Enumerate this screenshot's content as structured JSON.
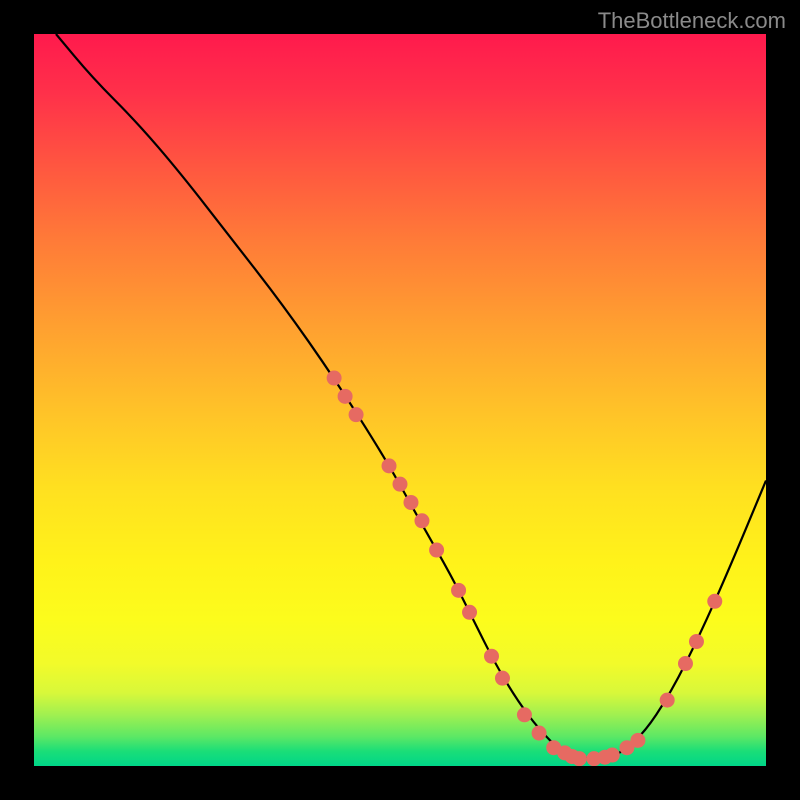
{
  "watermark": "TheBottleneck.com",
  "chart_data": {
    "type": "line",
    "title": "",
    "xlabel": "",
    "ylabel": "",
    "xlim": [
      0,
      100
    ],
    "ylim": [
      0,
      100
    ],
    "series": [
      {
        "name": "curve",
        "x": [
          3,
          8,
          14,
          20,
          27,
          34,
          41,
          48,
          53,
          57,
          60,
          63,
          66,
          69,
          72,
          75,
          79,
          83,
          87,
          91,
          95,
          100
        ],
        "y": [
          100,
          94,
          88,
          81,
          72,
          63,
          53,
          42,
          33,
          26,
          20,
          14,
          9,
          5,
          2,
          1,
          1,
          4,
          10,
          18,
          27,
          39
        ]
      }
    ],
    "markers": [
      {
        "x": 41.0,
        "y": 53.0
      },
      {
        "x": 42.5,
        "y": 50.5
      },
      {
        "x": 44.0,
        "y": 48.0
      },
      {
        "x": 48.5,
        "y": 41.0
      },
      {
        "x": 50.0,
        "y": 38.5
      },
      {
        "x": 51.5,
        "y": 36.0
      },
      {
        "x": 53.0,
        "y": 33.5
      },
      {
        "x": 55.0,
        "y": 29.5
      },
      {
        "x": 58.0,
        "y": 24.0
      },
      {
        "x": 59.5,
        "y": 21.0
      },
      {
        "x": 62.5,
        "y": 15.0
      },
      {
        "x": 64.0,
        "y": 12.0
      },
      {
        "x": 67.0,
        "y": 7.0
      },
      {
        "x": 69.0,
        "y": 4.5
      },
      {
        "x": 71.0,
        "y": 2.5
      },
      {
        "x": 72.5,
        "y": 1.8
      },
      {
        "x": 73.5,
        "y": 1.3
      },
      {
        "x": 74.5,
        "y": 1.0
      },
      {
        "x": 76.5,
        "y": 1.0
      },
      {
        "x": 78.0,
        "y": 1.2
      },
      {
        "x": 79.0,
        "y": 1.5
      },
      {
        "x": 81.0,
        "y": 2.5
      },
      {
        "x": 82.5,
        "y": 3.5
      },
      {
        "x": 86.5,
        "y": 9.0
      },
      {
        "x": 89.0,
        "y": 14.0
      },
      {
        "x": 90.5,
        "y": 17.0
      },
      {
        "x": 93.0,
        "y": 22.5
      }
    ],
    "gradient_stops": [
      {
        "pos": 0,
        "color": "#ff1a4d"
      },
      {
        "pos": 50,
        "color": "#ffc428"
      },
      {
        "pos": 80,
        "color": "#fcfc1c"
      },
      {
        "pos": 100,
        "color": "#00d688"
      }
    ]
  }
}
